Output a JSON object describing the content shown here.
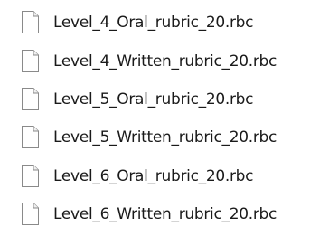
{
  "files": [
    {
      "name": "Level_4_Oral_rubric_20.rbc",
      "icon": "blank-file-icon"
    },
    {
      "name": "Level_4_Written_rubric_20.rbc",
      "icon": "blank-file-icon"
    },
    {
      "name": "Level_5_Oral_rubric_20.rbc",
      "icon": "blank-file-icon"
    },
    {
      "name": "Level_5_Written_rubric_20.rbc",
      "icon": "blank-file-icon"
    },
    {
      "name": "Level_6_Oral_rubric_20.rbc",
      "icon": "blank-file-icon"
    },
    {
      "name": "Level_6_Written_rubric_20.rbc",
      "icon": "blank-file-icon"
    }
  ]
}
